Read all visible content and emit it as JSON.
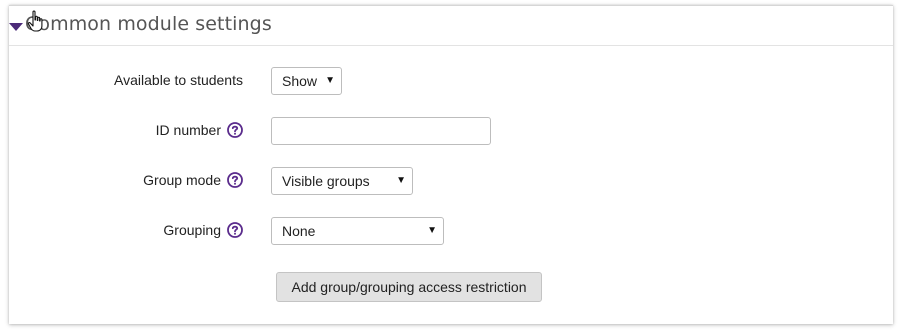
{
  "section": {
    "title": "Common module settings",
    "toggle_icon": "triangle-down-icon",
    "accent_color": "#4b2a78"
  },
  "fields": {
    "visibility": {
      "label": "Available to students",
      "value": "Show"
    },
    "idnumber": {
      "label": "ID number",
      "value": "",
      "help_icon": "question-circle-icon"
    },
    "groupmode": {
      "label": "Group mode",
      "value": "Visible groups",
      "help_icon": "question-circle-icon"
    },
    "grouping": {
      "label": "Grouping",
      "value": "None",
      "help_icon": "question-circle-icon"
    }
  },
  "actions": {
    "add_restriction_label": "Add group/grouping access restriction"
  },
  "cursor_icon": "hand-pointer-icon"
}
